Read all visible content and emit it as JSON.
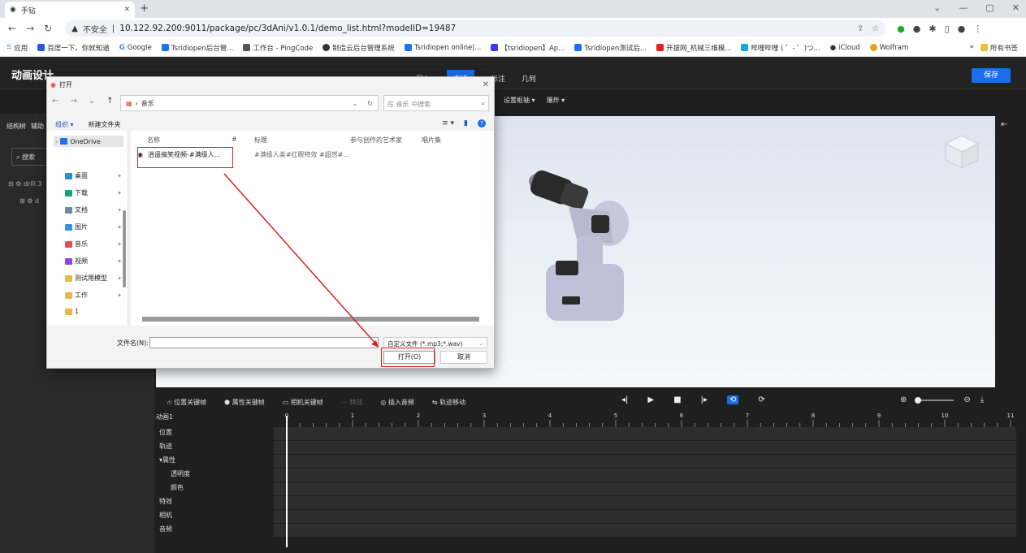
{
  "browser": {
    "tab_title": "手钻",
    "url_warning": "不安全",
    "url": "10.122.92.200:9011/package/pc/3dAni/v1.0.1/demo_list.html?modelID=19487",
    "bookmarks": [
      "应用",
      "百度一下，你就知道",
      "Google",
      "Tsridiopen后台管...",
      "工作台 - PingCode",
      "制造云后台管理系统",
      "Tsridiopen online|...",
      "【tsridiopen】Ap...",
      "Tsridiopen测试后...",
      "开拔网_机械三维模...",
      "哔哩哔哩 ( ゜- ゜)つ...",
      "iCloud",
      "Wolfram"
    ],
    "bookmarks_folder": "所有书签"
  },
  "app": {
    "title": "动画设计",
    "menu": [
      "导入",
      "交换",
      "标注",
      "几何"
    ],
    "save": "保存",
    "subtools": [
      "设置枢轴",
      "爆炸"
    ],
    "sidebar_tabs": [
      "结构树",
      "辅助"
    ],
    "search": "搜索",
    "tree": [
      "drill 3",
      "d"
    ]
  },
  "timeline": {
    "tools": [
      "位置关键帧",
      "属性关键帧",
      "相机关键帧",
      "特效",
      "插入音频",
      "轨迹移动"
    ],
    "anim_name": "动画1",
    "rows": [
      {
        "label": "位置",
        "sub": false
      },
      {
        "label": "轨迹",
        "sub": false
      },
      {
        "label": "▾属性",
        "sub": false
      },
      {
        "label": "透明度",
        "sub": true
      },
      {
        "label": "颜色",
        "sub": true
      },
      {
        "label": "特效",
        "sub": false
      },
      {
        "label": "相机",
        "sub": false
      },
      {
        "label": "音频",
        "sub": false
      }
    ],
    "ruler": [
      "0",
      "1",
      "2",
      "3",
      "4",
      "5",
      "6",
      "7",
      "8",
      "9",
      "10",
      "11"
    ]
  },
  "dialog": {
    "title": "打开",
    "path": "音乐",
    "search_placeholder": "在 音乐 中搜索",
    "organize": "组织 ▾",
    "new_folder": "新建文件夹",
    "nav": [
      {
        "label": "OneDrive",
        "color": "#1a73e8",
        "pin": false
      },
      {
        "label": "桌面",
        "color": "#2a8bd8",
        "pin": true
      },
      {
        "label": "下载",
        "color": "#1aa37a",
        "pin": true
      },
      {
        "label": "文档",
        "color": "#6a8ab0",
        "pin": true
      },
      {
        "label": "图片",
        "color": "#3a8ee8",
        "pin": true
      },
      {
        "label": "音乐",
        "color": "#e05050",
        "pin": true
      },
      {
        "label": "视频",
        "color": "#8a4ad8",
        "pin": true
      },
      {
        "label": "测试用模型",
        "color": "#e8b84a",
        "pin": true
      },
      {
        "label": "工作",
        "color": "#e8b84a",
        "pin": true
      },
      {
        "label": "1",
        "color": "#e8b84a",
        "pin": false
      }
    ],
    "columns": [
      "名称",
      "#",
      "标题",
      "参与创作的艺术家",
      "唱片集"
    ],
    "file": {
      "name": "逍遥搞笑视频-#满级人...",
      "title": "#满级人类#红眼特效 #超然#..."
    },
    "filename_label": "文件名(N):",
    "filter": "自定义文件 (*.mp3;*.wav)",
    "open": "打开(O)",
    "cancel": "取消"
  }
}
